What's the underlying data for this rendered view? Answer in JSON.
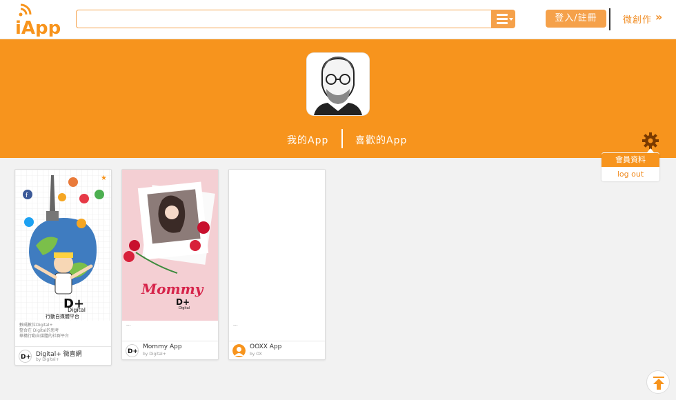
{
  "header": {
    "logo_text": "iApp",
    "search": {
      "value": "",
      "placeholder": ""
    },
    "login_label": "登入/註冊",
    "micro_label": "微創作",
    "micro_arrow": "»"
  },
  "profile": {
    "tabs": [
      {
        "label": "我的App"
      },
      {
        "label": "喜歡的App"
      }
    ],
    "settings_menu": {
      "items": [
        {
          "label": "會員資料"
        },
        {
          "label": "log out"
        }
      ]
    }
  },
  "apps": [
    {
      "desc_lines": [
        "數碼數位Digital+",
        "整合在 Digital的思考",
        "華構行動自媒體的社群平台"
      ],
      "name": "Digital+ 微喜網",
      "by": "by Digital+",
      "poster_brand": "Digital",
      "poster_sub": "行動自媒體平台",
      "starred": "★"
    },
    {
      "desc_lines": [
        "---"
      ],
      "name": "Mommy App",
      "by": "by Digital+",
      "poster_title": "Mommy",
      "poster_brand": "Digital"
    },
    {
      "desc_lines": [
        "---"
      ],
      "name": "OOXX App",
      "by": "by OX"
    }
  ],
  "colors": {
    "accent": "#f7941d",
    "accent_dark": "#f08a1e",
    "bg": "#f2f2f2"
  },
  "icons": [
    "menu-icon",
    "gear-icon",
    "star-icon",
    "back-to-top-icon",
    "double-chevron-right-icon"
  ]
}
